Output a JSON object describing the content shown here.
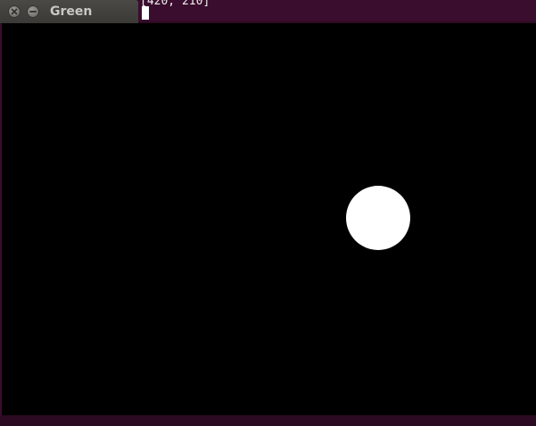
{
  "terminal": {
    "output_text": "[420, 210]"
  },
  "window": {
    "title": "Green",
    "close_icon": "close-icon",
    "minimize_icon": "minimize-icon"
  },
  "canvas": {
    "background_color": "#000000",
    "circle_color": "#ffffff"
  }
}
